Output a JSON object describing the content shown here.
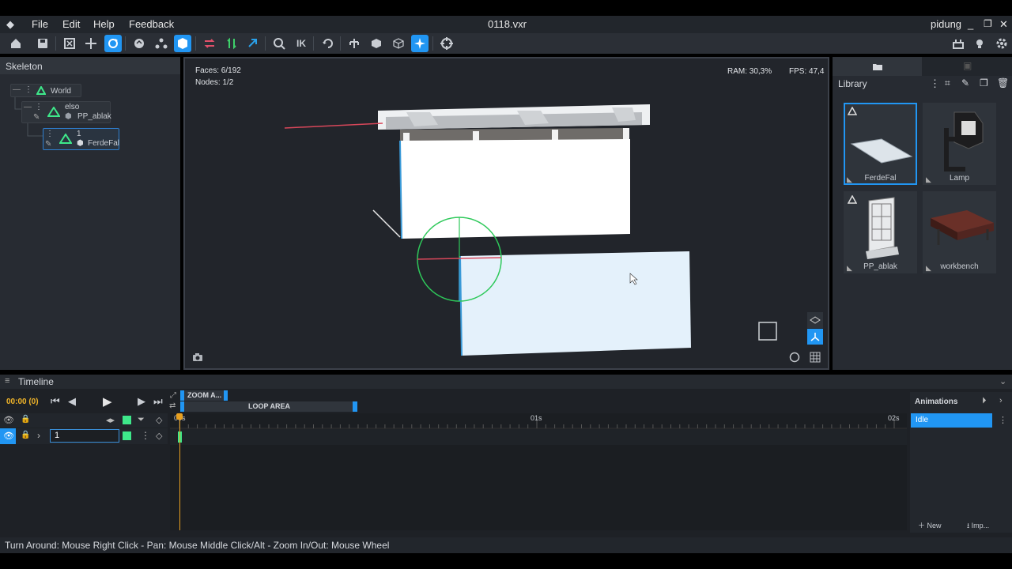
{
  "app": {
    "filename": "0118.vxr",
    "user": "pidung",
    "menu": [
      "File",
      "Edit",
      "Help",
      "Feedback"
    ]
  },
  "toolbar": {
    "icons": [
      "home-icon",
      "save-icon",
      "fit-view-icon",
      "move-icon",
      "rotate-icon",
      "sphere-icon",
      "hierarchy-icon",
      "cube-icon",
      "mirror-x-icon",
      "mirror-y-icon",
      "mirror-z-icon",
      "snap-icon",
      "ik-icon",
      "refresh-icon",
      "skeleton-icon",
      "box-solid-icon",
      "box-wire-icon",
      "star-icon",
      "target-icon"
    ],
    "ik_label": "IK",
    "right_icons": [
      "lamp-scene-icon",
      "light-icon",
      "settings-icon"
    ]
  },
  "skeleton": {
    "title": "Skeleton",
    "nodes": [
      {
        "label": "World"
      },
      {
        "label": "elso",
        "sub": "PP_ablak"
      },
      {
        "label": "1",
        "sub": "FerdeFal"
      }
    ]
  },
  "viewport": {
    "faces": "Faces: 6/192",
    "nodes": "Nodes: 1/2",
    "ram": "RAM: 30,3%",
    "fps": "FPS: 47,4"
  },
  "library": {
    "title": "Library",
    "items": [
      {
        "name": "FerdeFal",
        "selected": true
      },
      {
        "name": "Lamp",
        "selected": false
      },
      {
        "name": "PP_ablak",
        "selected": false
      },
      {
        "name": "workbench",
        "selected": false
      }
    ]
  },
  "timeline": {
    "title": "Timeline",
    "time": "00:00 (0)",
    "zoom_area": "ZOOM A...",
    "loop_area": "LOOP AREA",
    "ticks": [
      "00s",
      "01s",
      "02s"
    ],
    "track_name": "1",
    "animations_title": "Animations",
    "animation_selected": "Idle",
    "new_label": "New",
    "import_label": "Imp..."
  },
  "status": {
    "text": "Turn Around: Mouse Right Click - Pan: Mouse Middle Click/Alt - Zoom In/Out: Mouse Wheel"
  },
  "colors": {
    "accent": "#2196f3",
    "keyframe": "#3ee88a",
    "gizmo_green": "#2ec95a",
    "axis_red": "#d8475a"
  }
}
